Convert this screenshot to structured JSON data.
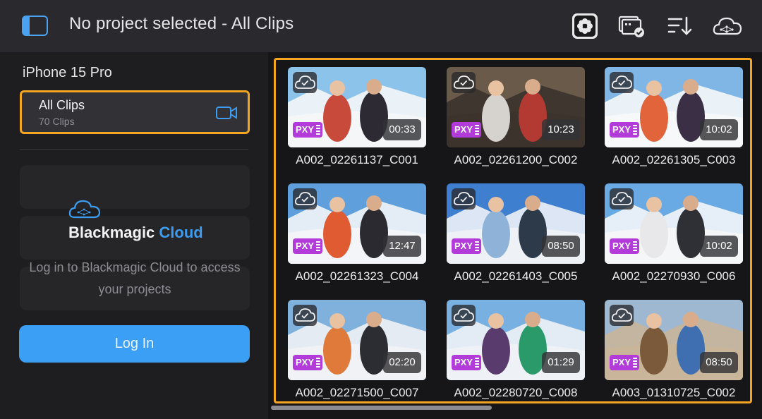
{
  "header": {
    "title": "No project selected - All Clips",
    "icons": [
      "sidebar-toggle-icon",
      "blackmagic-app-icon",
      "sync-cards-icon",
      "sort-icon",
      "cloud-network-icon"
    ],
    "accent_color": "#4aa2f0"
  },
  "sidebar": {
    "device_name": "iPhone 15 Pro",
    "all_clips": {
      "label": "All Clips",
      "count": "70 Clips",
      "selected_border_color": "#f4a523"
    },
    "cloud_brand": {
      "prefix": "Blackmagic",
      "suffix": "Cloud"
    },
    "login_message": "Log in to Blackmagic Cloud to access your projects",
    "login_button": "Log In",
    "login_button_color": "#3a9ff5"
  },
  "clips": [
    {
      "name": "A002_02261137_C001",
      "duration": "00:33",
      "badge": "PXY"
    },
    {
      "name": "A002_02261200_C002",
      "duration": "10:23",
      "badge": "PXY"
    },
    {
      "name": "A002_02261305_C003",
      "duration": "10:02",
      "badge": "PXY"
    },
    {
      "name": "A002_02261323_C004",
      "duration": "12:47",
      "badge": "PXY"
    },
    {
      "name": "A002_02261403_C005",
      "duration": "08:50",
      "badge": "PXY"
    },
    {
      "name": "A002_02270930_C006",
      "duration": "10:02",
      "badge": "PXY"
    },
    {
      "name": "A002_02271500_C007",
      "duration": "02:20",
      "badge": "PXY"
    },
    {
      "name": "A002_02280720_C008",
      "duration": "01:29",
      "badge": "PXY"
    },
    {
      "name": "A003_01310725_C002",
      "duration": "08:50",
      "badge": "PXY"
    }
  ]
}
